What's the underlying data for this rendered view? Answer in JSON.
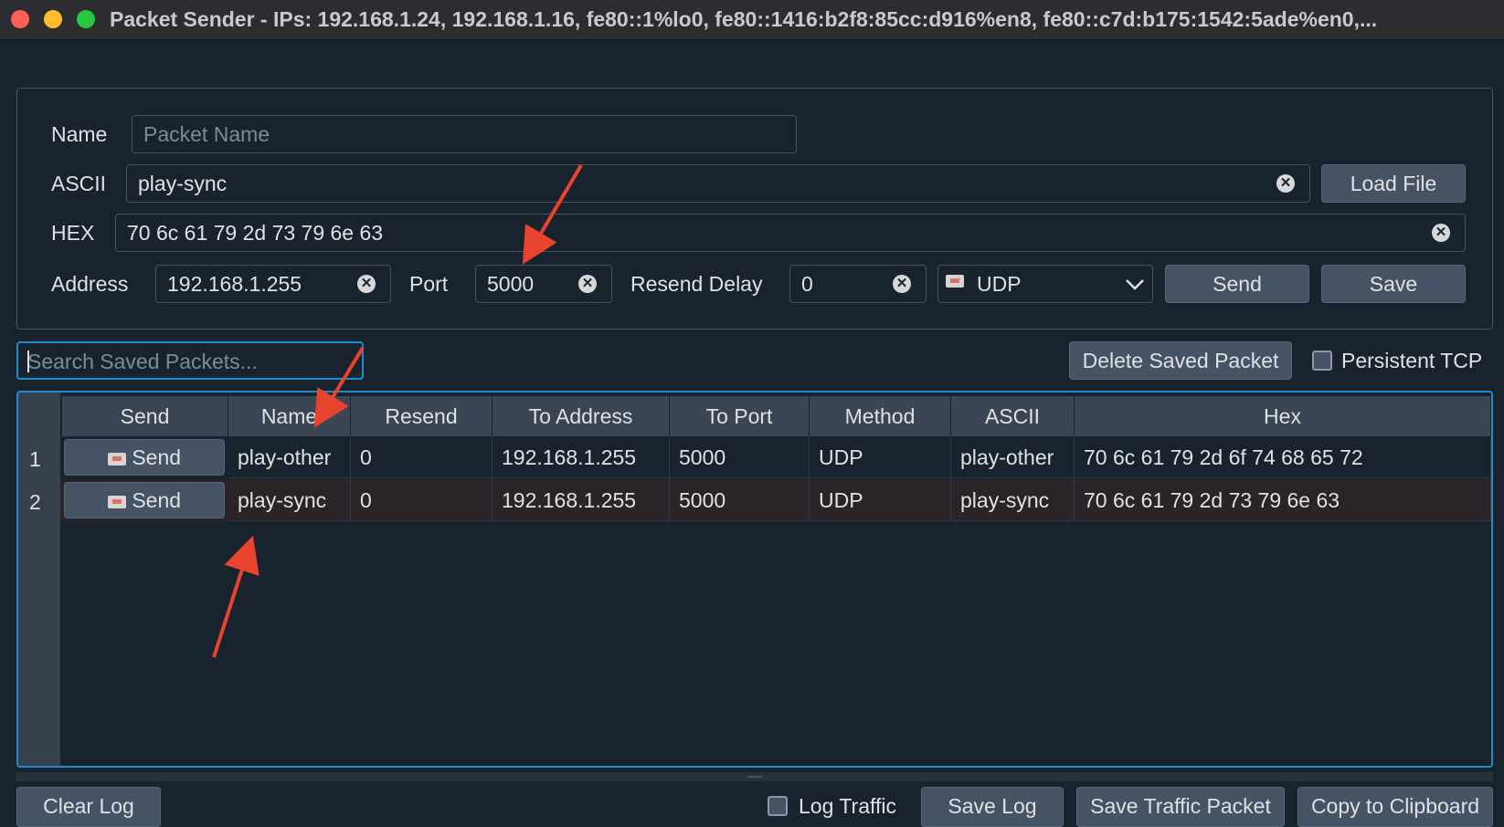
{
  "window": {
    "title": "Packet Sender - IPs: 192.168.1.24, 192.168.1.16, fe80::1%lo0, fe80::1416:b2f8:85cc:d916%en8, fe80::c7d:b175:1542:5ade%en0,..."
  },
  "packet_form": {
    "name_label": "Name",
    "name_placeholder": "Packet Name",
    "name_value": "",
    "ascii_label": "ASCII",
    "ascii_value": "play-sync",
    "load_file_label": "Load File",
    "hex_label": "HEX",
    "hex_value": "70 6c 61 79 2d 73 79 6e 63",
    "address_label": "Address",
    "address_value": "192.168.1.255",
    "port_label": "Port",
    "port_value": "5000",
    "resend_delay_label": "Resend Delay",
    "resend_delay_value": "0",
    "method_value": "UDP",
    "send_label": "Send",
    "save_label": "Save"
  },
  "toolbar": {
    "search_placeholder": "Search Saved Packets...",
    "delete_label": "Delete Saved Packet",
    "persistent_tcp_label": "Persistent TCP"
  },
  "table": {
    "headers": [
      "Send",
      "Name",
      "Resend",
      "To Address",
      "To Port",
      "Method",
      "ASCII",
      "Hex"
    ],
    "rows": [
      {
        "num": "1",
        "send": "Send",
        "name": "play-other",
        "resend": "0",
        "address": "192.168.1.255",
        "port": "5000",
        "method": "UDP",
        "ascii": "play-other",
        "hex": "70 6c 61 79 2d 6f 74 68 65 72"
      },
      {
        "num": "2",
        "send": "Send",
        "name": "play-sync",
        "resend": "0",
        "address": "192.168.1.255",
        "port": "5000",
        "method": "UDP",
        "ascii": "play-sync",
        "hex": "70 6c 61 79 2d 73 79 6e 63"
      }
    ]
  },
  "bottom": {
    "clear_log_label": "Clear Log",
    "log_traffic_label": "Log Traffic",
    "save_log_label": "Save Log",
    "save_traffic_label": "Save Traffic Packet",
    "copy_clipboard_label": "Copy to Clipboard"
  },
  "icons": {
    "clear": "clear-icon",
    "mail": "mail-icon",
    "dropdown": "chevron-down-icon",
    "annotation": "arrow-annotation"
  },
  "colors": {
    "background": "#19232d",
    "accent": "#1e8bd1",
    "annotation_arrow": "#e8432c",
    "selected_row": "#2a2327"
  }
}
